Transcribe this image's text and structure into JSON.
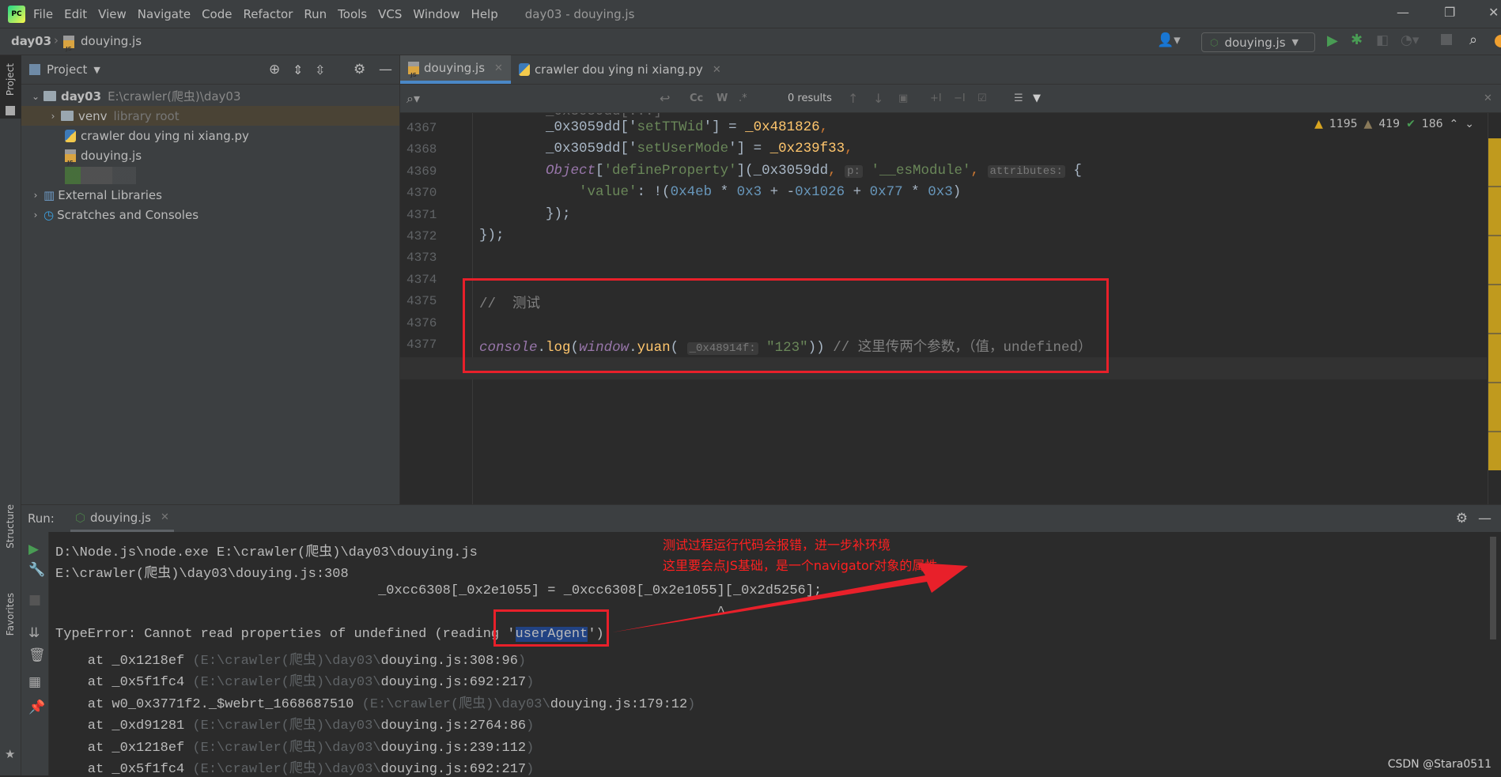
{
  "window": {
    "title": "day03 - douying.js",
    "menu": [
      "File",
      "Edit",
      "View",
      "Navigate",
      "Code",
      "Refactor",
      "Run",
      "Tools",
      "VCS",
      "Window",
      "Help"
    ]
  },
  "nav": {
    "project": "day03",
    "file": "douying.js",
    "run_config": "douying.js"
  },
  "sidebar": {
    "left_tabs": [
      "Project",
      "Structure",
      "Favorites"
    ],
    "header": "Project",
    "tree": [
      {
        "label": "day03",
        "hint": "E:\\crawler(爬虫)\\day03"
      },
      {
        "label": "venv",
        "hint": "library root"
      },
      {
        "label": "crawler dou ying ni xiang.py"
      },
      {
        "label": "douying.js"
      },
      {
        "label": "External Libraries"
      },
      {
        "label": "Scratches and Consoles"
      }
    ]
  },
  "editor": {
    "tabs": [
      "douying.js",
      "crawler dou ying ni xiang.py"
    ],
    "find_results": "0 results",
    "inspections": {
      "warnings": "1195",
      "weak_warnings": "419",
      "typos": "186"
    },
    "lines": [
      {
        "n": "4367",
        "tokens": [
          [
            "        _0x3059dd['",
            ""
          ],
          [
            "setTTWid",
            "str"
          ],
          [
            "'] = ",
            ""
          ],
          [
            "_0x481826",
            "var"
          ],
          [
            ",",
            "punc"
          ]
        ]
      },
      {
        "n": "4368",
        "tokens": [
          [
            "        _0x3059dd['",
            ""
          ],
          [
            "setUserMode",
            "str"
          ],
          [
            "'] = ",
            ""
          ],
          [
            "_0x239f33",
            "var"
          ],
          [
            ",",
            "punc"
          ]
        ]
      },
      {
        "n": "4369",
        "tokens": [
          [
            "        ",
            ""
          ],
          [
            "Object",
            "kw"
          ],
          [
            "[",
            ""
          ],
          [
            "'defineProperty'",
            "str"
          ],
          [
            "](_0x3059dd",
            ""
          ],
          [
            ", ",
            "punc"
          ],
          [
            "p:",
            "hint"
          ],
          [
            " ",
            ""
          ],
          [
            "'__esModule'",
            "str"
          ],
          [
            ", ",
            "punc"
          ],
          [
            "attributes:",
            "hint"
          ],
          [
            " {",
            ""
          ]
        ]
      },
      {
        "n": "4370",
        "tokens": [
          [
            "            ",
            ""
          ],
          [
            "'value'",
            "str"
          ],
          [
            ": !(",
            ""
          ],
          [
            "0x4eb",
            "num"
          ],
          [
            " * ",
            ""
          ],
          [
            "0x3",
            "num"
          ],
          [
            " + -",
            ""
          ],
          [
            "0x1026",
            "num"
          ],
          [
            " + ",
            ""
          ],
          [
            "0x77",
            "num"
          ],
          [
            " * ",
            ""
          ],
          [
            "0x3",
            "num"
          ],
          [
            ")",
            ""
          ]
        ]
      },
      {
        "n": "4371",
        "tokens": [
          [
            "        });",
            ""
          ]
        ]
      },
      {
        "n": "4372",
        "tokens": [
          [
            "});",
            ""
          ]
        ]
      },
      {
        "n": "4373",
        "tokens": []
      },
      {
        "n": "4374",
        "tokens": []
      },
      {
        "n": "4375",
        "tokens": [
          [
            "//  测试",
            "cmt"
          ]
        ]
      },
      {
        "n": "4376",
        "tokens": []
      },
      {
        "n": "4377",
        "tokens": [
          [
            "console",
            "kw"
          ],
          [
            ".",
            ""
          ],
          [
            "log",
            "fn"
          ],
          [
            "(",
            ""
          ],
          [
            "window",
            "kw"
          ],
          [
            ".",
            ""
          ],
          [
            "yuan",
            "fn"
          ],
          [
            "( ",
            ""
          ],
          [
            "_0x48914f:",
            "hint"
          ],
          [
            " ",
            ""
          ],
          [
            "\"123\"",
            "str"
          ],
          [
            ")) ",
            ""
          ],
          [
            "// 这里传两个参数，（值，undefined）",
            "cmt"
          ]
        ]
      }
    ]
  },
  "run": {
    "label": "Run:",
    "tab": "douying.js",
    "lines": [
      [
        [
          "D:\\Node.js\\node.exe E:\\crawler(爬虫)\\day03\\douying.js",
          ""
        ]
      ],
      [
        [
          "E:\\crawler(爬虫)\\day03\\douying.js:308",
          ""
        ]
      ],
      [
        [
          "                                        _0xcc6308[_0x2e1055] = _0xcc6308[_0x2e1055][_0x2d5256];",
          ""
        ]
      ],
      [
        [
          "                                                                                  ^",
          ""
        ]
      ],
      [
        [
          "TypeError: Cannot read properties of undefined (reading '",
          ""
        ],
        [
          "userAgent",
          "sel"
        ],
        [
          "')",
          ""
        ]
      ],
      [
        [
          "    at _0x1218ef ",
          ""
        ],
        [
          "(E:\\crawler(爬虫)\\day03\\",
          "dim"
        ],
        [
          "douying.js:308:96",
          ""
        ],
        [
          ")",
          "dim"
        ]
      ],
      [
        [
          "    at _0x5f1fc4 ",
          ""
        ],
        [
          "(E:\\crawler(爬虫)\\day03\\",
          "dim"
        ],
        [
          "douying.js:692:217",
          ""
        ],
        [
          ")",
          "dim"
        ]
      ],
      [
        [
          "    at w0_0x3771f2._$webrt_1668687510 ",
          ""
        ],
        [
          "(E:\\crawler(爬虫)\\day03\\",
          "dim"
        ],
        [
          "douying.js:179:12",
          ""
        ],
        [
          ")",
          "dim"
        ]
      ],
      [
        [
          "    at _0xd91281 ",
          ""
        ],
        [
          "(E:\\crawler(爬虫)\\day03\\",
          "dim"
        ],
        [
          "douying.js:2764:86",
          ""
        ],
        [
          ")",
          "dim"
        ]
      ],
      [
        [
          "    at _0x1218ef ",
          ""
        ],
        [
          "(E:\\crawler(爬虫)\\day03\\",
          "dim"
        ],
        [
          "douying.js:239:112",
          ""
        ],
        [
          ")",
          "dim"
        ]
      ],
      [
        [
          "    at _0x5f1fc4 ",
          ""
        ],
        [
          "(E:\\crawler(爬虫)\\day03\\",
          "dim"
        ],
        [
          "douying.js:692:217",
          ""
        ],
        [
          ")",
          "dim"
        ]
      ]
    ]
  },
  "annotation": {
    "line1": "测试过程运行代码会报错，进一步补环境",
    "line2": "这里要会点JS基础，是一个navigator对象的属性"
  },
  "watermark": "CSDN @Stara0511",
  "colors": {
    "annotation": "#e8202a",
    "accent": "#4a88c7",
    "selection": "#214283"
  }
}
